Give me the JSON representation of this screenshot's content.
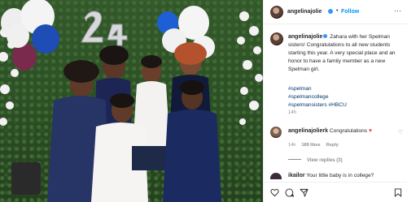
{
  "post": {
    "username": "angelinajolie",
    "follow_label": "Follow",
    "dot": "•",
    "more": "···",
    "caption_text": " Zahara with her Spelman sisters! Congratulations to all new students starting this year. A very special place and an honor to have a family member as a new Spelman girl.",
    "hashtags": [
      "#spelman",
      "#spelmancollege",
      "#spelmansisters",
      "#HBCU"
    ],
    "caption_time": "14h"
  },
  "comments": [
    {
      "username": "angelinajolierk",
      "text": "Congratulations",
      "emoji": "♥",
      "time": "14h",
      "likes": "189 likes",
      "reply": "Reply"
    }
  ],
  "view_replies": "View replies (3)",
  "comment2": {
    "username": "ikailor",
    "text": "Your little baby is in college?"
  },
  "colors": {
    "link": "#00376b",
    "follow": "#0095f6",
    "verified": "#3897f0",
    "heart": "#ed4956"
  },
  "icons": [
    "heart-icon",
    "comment-icon",
    "share-icon",
    "bookmark-icon",
    "more-icon",
    "verified-icon"
  ],
  "photo": {
    "balloon_numbers": [
      "2",
      "4"
    ]
  }
}
